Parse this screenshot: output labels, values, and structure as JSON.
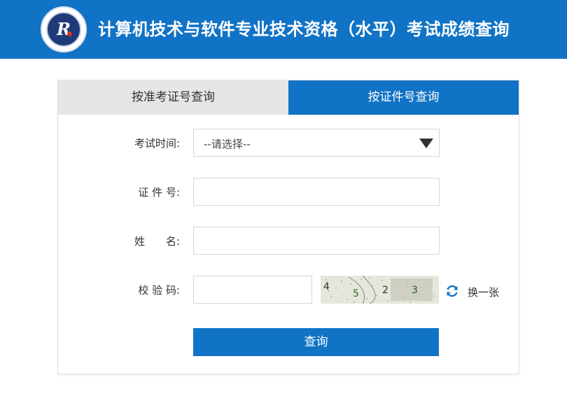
{
  "header": {
    "title": "计算机技术与软件专业技术资格（水平）考试成绩查询",
    "logo_mark": "R",
    "colors": {
      "brand": "#1173c5",
      "tab_inactive": "#e6e6e6"
    }
  },
  "tabs": [
    {
      "label": "按准考证号查询",
      "active": false
    },
    {
      "label": "按证件号查询",
      "active": true
    }
  ],
  "form": {
    "exam_time": {
      "label": "考试时间:",
      "value": "--请选择--",
      "icon": "chevron-down-icon"
    },
    "id_number": {
      "label": "证 件 号:",
      "value": ""
    },
    "name": {
      "label": "姓　　名:",
      "value": ""
    },
    "captcha": {
      "label": "校 验 码:",
      "value": "",
      "image_chars": [
        "4",
        "5",
        "2",
        "3"
      ],
      "refresh_label": "换一张",
      "refresh_icon": "refresh-icon"
    },
    "submit_label": "查询"
  }
}
